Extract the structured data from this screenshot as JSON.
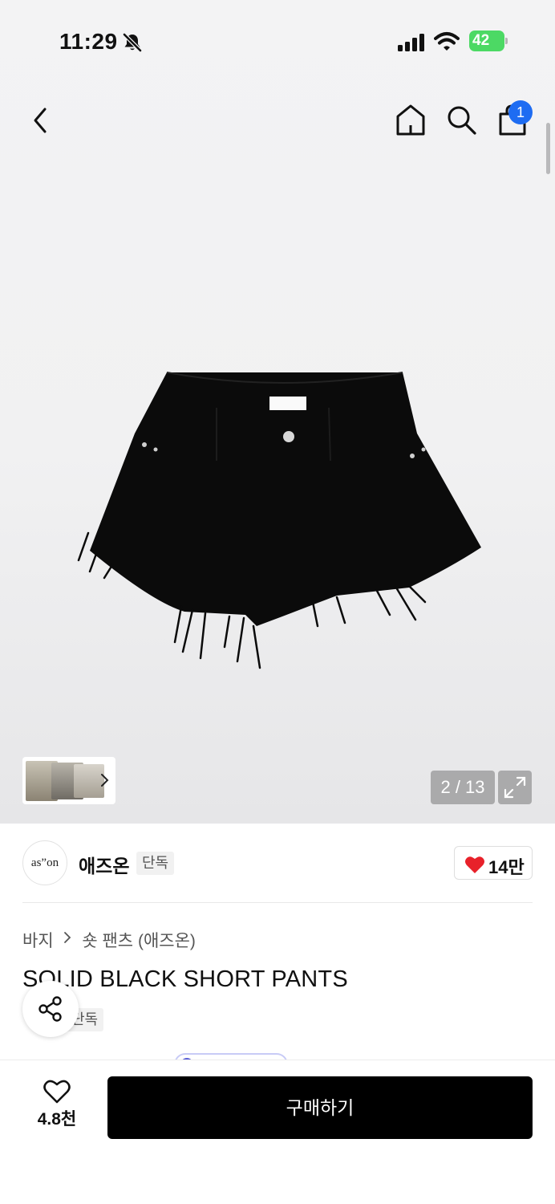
{
  "status_bar": {
    "time": "11:29",
    "battery": "42",
    "battery_color": "#4cd964"
  },
  "nav": {
    "cart_count": "1",
    "badge_color": "#1e6cf2"
  },
  "gallery": {
    "counter": "2 / 13"
  },
  "brand": {
    "logo_text": "as”on",
    "name": "애즈온",
    "tag": "단독",
    "likes": "14만"
  },
  "product": {
    "breadcrumb": [
      "바지",
      "숏 팬츠 (애즈온)"
    ],
    "title": "SOLID BLACK SHORT PANTS",
    "tag": "단독"
  },
  "bottom_bar": {
    "wish_count": "4.8천",
    "buy_label": "구매하기"
  }
}
